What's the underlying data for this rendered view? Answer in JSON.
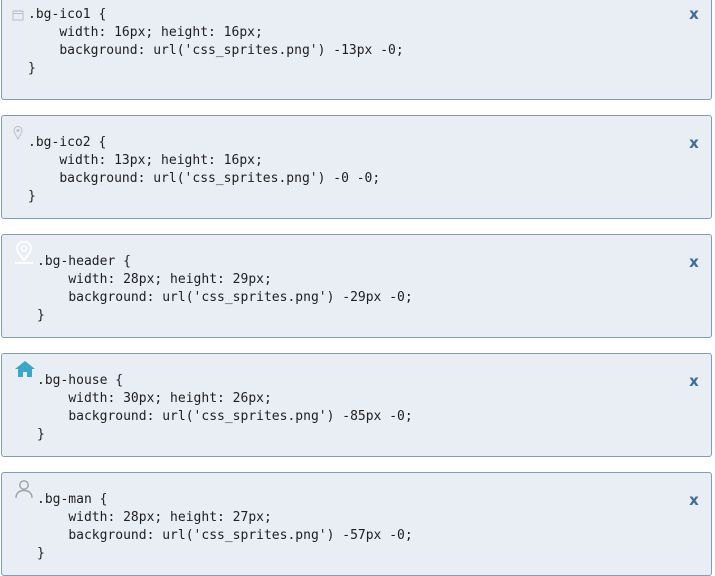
{
  "cards": [
    {
      "selector_line": ".bg-ico1 {",
      "width_line": "width: 16px; height: 16px;",
      "bg_line": "background: url('css_sprites.png') -13px -0;",
      "close_line": "}",
      "close_label": "x",
      "icon": "calendar-icon"
    },
    {
      "selector_line": ".bg-ico2 {",
      "width_line": "width: 13px; height: 16px;",
      "bg_line": "background: url('css_sprites.png') -0 -0;",
      "close_line": "}",
      "close_label": "x",
      "icon": "location-pin-icon"
    },
    {
      "selector_line": ".bg-header {",
      "width_line": "width: 28px; height: 29px;",
      "bg_line": "background: url('css_sprites.png') -29px -0;",
      "close_line": "}",
      "close_label": "x",
      "icon": "map-marker-icon"
    },
    {
      "selector_line": ".bg-house {",
      "width_line": "width: 30px; height: 26px;",
      "bg_line": "background: url('css_sprites.png') -85px -0;",
      "close_line": "}",
      "close_label": "x",
      "icon": "house-icon"
    },
    {
      "selector_line": ".bg-man {",
      "width_line": "width: 28px; height: 27px;",
      "bg_line": "background: url('css_sprites.png') -57px -0;",
      "close_line": "}",
      "close_label": "x",
      "icon": "person-icon"
    }
  ],
  "colors": {
    "card_background": "#e9edf4",
    "card_border": "#7f9db9",
    "close_button": "#3f6d9a",
    "house_icon": "#3aa6c9"
  }
}
